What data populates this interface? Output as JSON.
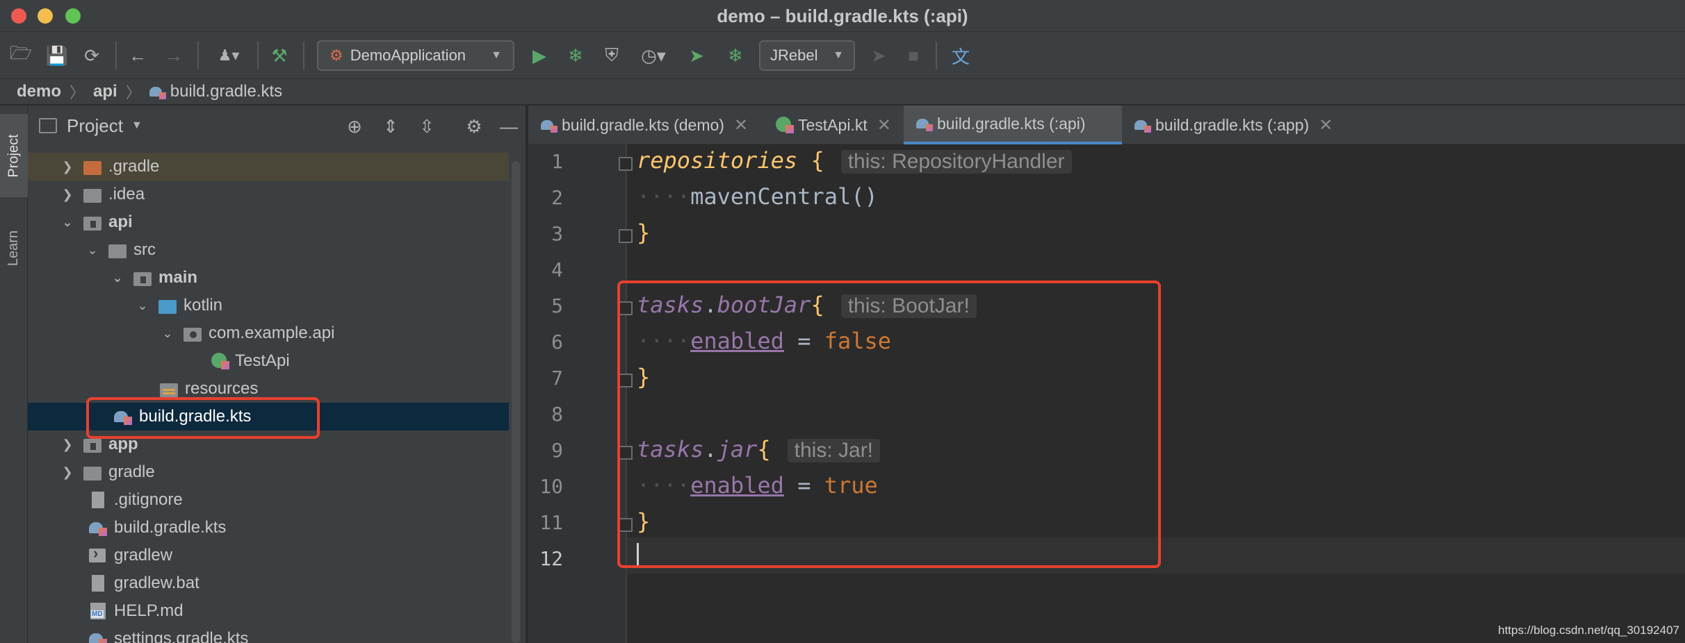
{
  "window": {
    "title": "demo – build.gradle.kts (:api)"
  },
  "toolbar": {
    "run_config": "DemoApplication",
    "jrebel": "JRebel"
  },
  "breadcrumb": {
    "items": [
      "demo",
      "api",
      "build.gradle.kts"
    ]
  },
  "sidebar": {
    "tabs": [
      "Project",
      "Learn"
    ]
  },
  "project_panel": {
    "title": "Project",
    "tree": [
      {
        "label": ".gradle"
      },
      {
        "label": ".idea"
      },
      {
        "label": "api"
      },
      {
        "label": "src"
      },
      {
        "label": "main"
      },
      {
        "label": "kotlin"
      },
      {
        "label": "com.example.api"
      },
      {
        "label": "TestApi"
      },
      {
        "label": "resources"
      },
      {
        "label": "build.gradle.kts"
      },
      {
        "label": "app"
      },
      {
        "label": "gradle"
      },
      {
        "label": ".gitignore"
      },
      {
        "label": "build.gradle.kts"
      },
      {
        "label": "gradlew"
      },
      {
        "label": "gradlew.bat"
      },
      {
        "label": "HELP.md"
      },
      {
        "label": "settings.gradle.kts"
      }
    ]
  },
  "editor": {
    "tabs": [
      {
        "label": "build.gradle.kts (demo)"
      },
      {
        "label": "TestApi.kt"
      },
      {
        "label": "build.gradle.kts (:api)"
      },
      {
        "label": "build.gradle.kts (:app)"
      }
    ],
    "line_numbers": [
      "1",
      "2",
      "3",
      "4",
      "5",
      "6",
      "7",
      "8",
      "9",
      "10",
      "11",
      "12"
    ],
    "code": {
      "l1_fn": "repositories",
      "l1_brace": "{",
      "l1_hint": "this: RepositoryHandler",
      "l2_dots": "····",
      "l2_fn": "mavenCentral()",
      "l3_brace": "}",
      "l5_obj": "tasks",
      "l5_dot": ".",
      "l5_fn": "bootJar",
      "l5_brace": "{",
      "l5_hint": "this: BootJar!",
      "l6_dots": "····",
      "l6_prop": "enabled",
      "l6_eq": " = ",
      "l6_val": "false",
      "l7_brace": "}",
      "l9_obj": "tasks",
      "l9_dot": ".",
      "l9_fn": "jar",
      "l9_brace": "{",
      "l9_hint": "this: Jar!",
      "l10_dots": "····",
      "l10_prop": "enabled",
      "l10_eq": " = ",
      "l10_val": "true",
      "l11_brace": "}"
    }
  },
  "watermark": "https://blog.csdn.net/qq_30192407",
  "colors": {
    "annotation": "#e8402e",
    "selection": "#0d293e",
    "active_tab_underline": "#4a88c7"
  }
}
